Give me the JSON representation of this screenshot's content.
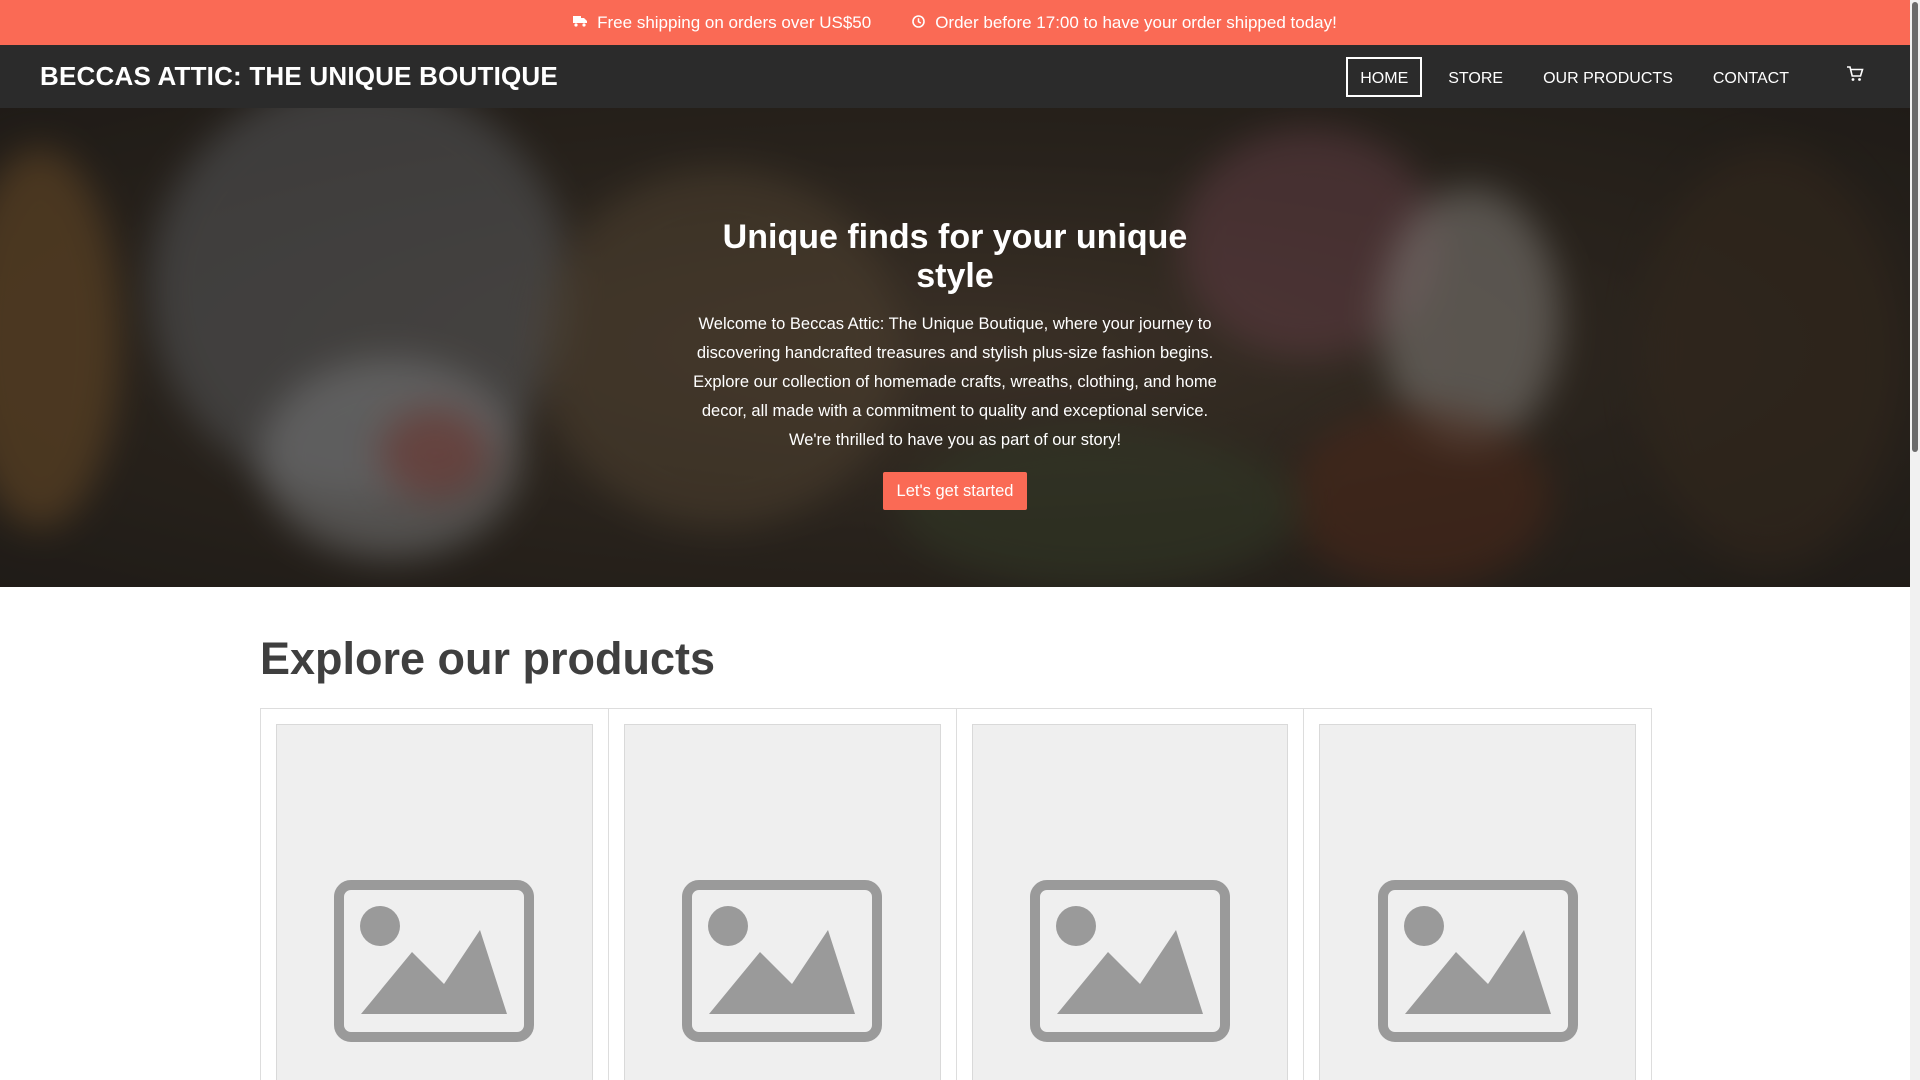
{
  "announcement": {
    "items": [
      {
        "icon": "truck-icon",
        "text": "Free shipping on orders over US$50"
      },
      {
        "icon": "clock-icon",
        "text": "Order before 17:00 to have your order shipped today!"
      }
    ]
  },
  "header": {
    "brand": "BECCAS ATTIC: THE UNIQUE BOUTIQUE",
    "nav": [
      {
        "label": "HOME",
        "active": true
      },
      {
        "label": "STORE"
      },
      {
        "label": "OUR PRODUCTS"
      },
      {
        "label": "CONTACT"
      }
    ],
    "cart_icon": "cart-icon"
  },
  "hero": {
    "title": "Unique finds for your unique style",
    "text": "Welcome to Beccas Attic: The Unique Boutique, where your journey to discovering handcrafted treasures and stylish plus-size fashion begins. Explore our collection of homemade crafts, wreaths, clothing, and home decor, all made with a commitment to quality and exceptional service. We're thrilled to have you as part of our story!",
    "button": "Let's get started"
  },
  "products": {
    "title": "Explore our products",
    "cards": [
      {
        "image_icon": "image-placeholder-icon"
      },
      {
        "image_icon": "image-placeholder-icon"
      },
      {
        "image_icon": "image-placeholder-icon"
      },
      {
        "image_icon": "image-placeholder-icon"
      }
    ]
  },
  "colors": {
    "accent": "#fa6a55",
    "navbar": "#2b2b2b",
    "heading": "#3f3f3f",
    "placeholder_bg": "#efefef",
    "placeholder_icon": "#9a9a9a"
  }
}
